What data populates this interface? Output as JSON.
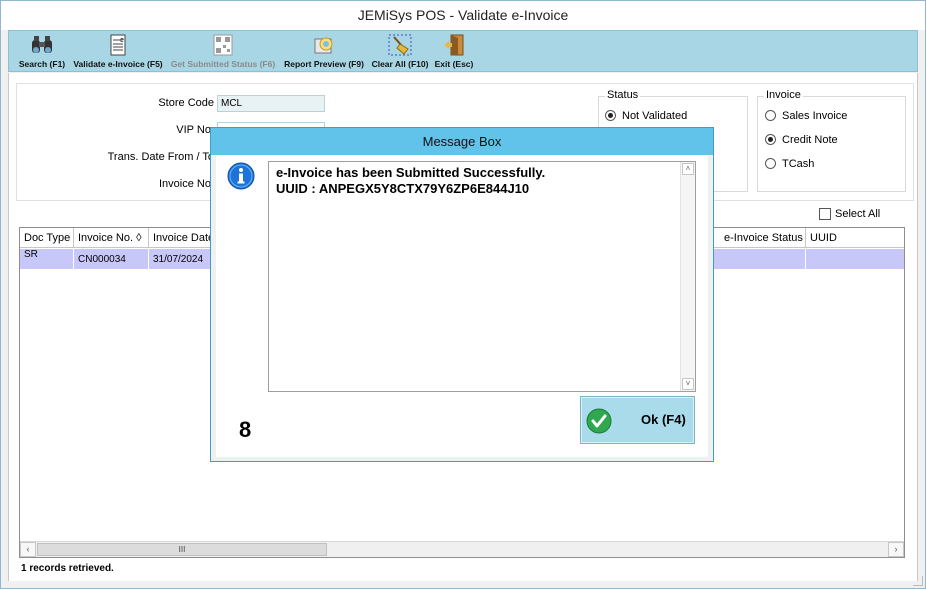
{
  "window": {
    "title": "JEMiSys POS - Validate e-Invoice"
  },
  "toolbar": {
    "search": "Search (F1)",
    "validate": "Validate e-Invoice (F5)",
    "get_status": "Get Submitted Status (F6)",
    "report_preview": "Report Preview (F9)",
    "clear_all": "Clear All (F10)",
    "exit": "Exit (Esc)"
  },
  "filters": {
    "store_code_label": "Store Code",
    "store_code_value": "MCL",
    "vip_label": "VIP No.",
    "date_label": "Trans. Date From / To",
    "invoice_no_label": "Invoice No."
  },
  "status_group": {
    "title": "Status",
    "options": [
      "Not Validated"
    ],
    "selected": "Not Validated"
  },
  "invoice_group": {
    "title": "Invoice",
    "options": [
      "Sales Invoice",
      "Credit Note",
      "TCash"
    ],
    "selected": "Credit Note"
  },
  "select_all_label": "Select All",
  "grid": {
    "columns": [
      "Doc Type",
      "Invoice No. ◊",
      "Invoice Date",
      "e-Invoice Status",
      "UUID"
    ],
    "rows": [
      {
        "doc_type": "SR",
        "invoice_no": "CN000034",
        "invoice_date": "31/07/2024",
        "einvoice_status": "",
        "uuid": ""
      }
    ],
    "hscroll_thumb": "III"
  },
  "status_bar": "1 records retrieved.",
  "message_box": {
    "title": "Message Box",
    "lines": [
      "e-Invoice has been Submitted Successfully.",
      "UUID : ANPEGX5Y8CTX79Y6ZP6E844J10"
    ],
    "counter": "8",
    "ok_label": "Ok (F4)"
  },
  "colors": {
    "toolbar_bg": "#a9d6e5",
    "title_bar_msg": "#61c2ea",
    "selected_row": "#c8c8f8",
    "ok_button": "#a9dbea",
    "info_icon": "#1e73d9",
    "check_icon": "#2fa84f"
  }
}
